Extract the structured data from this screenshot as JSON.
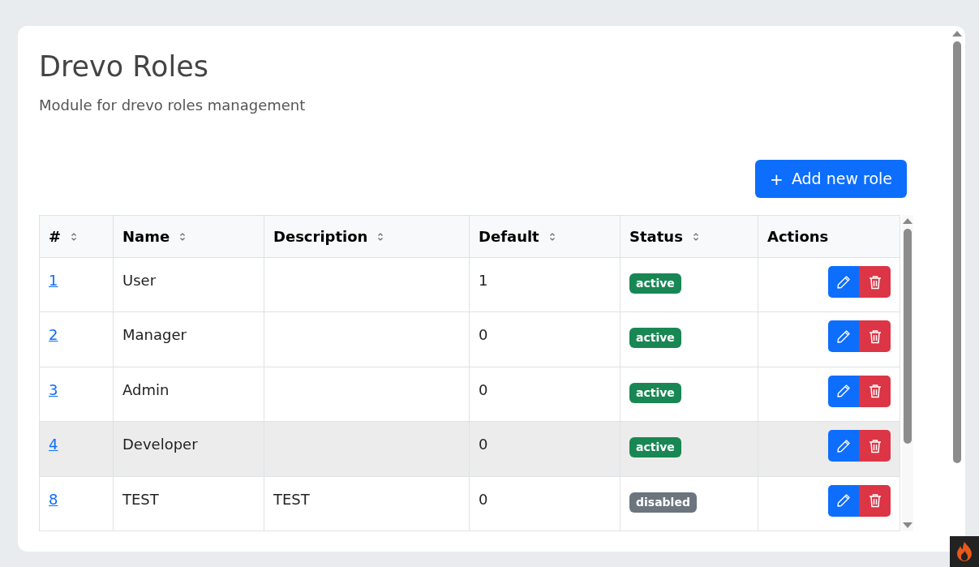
{
  "page": {
    "title": "Drevo Roles",
    "subtitle": "Module for drevo roles management"
  },
  "add_button": {
    "icon": "+",
    "label": "Add new role"
  },
  "table": {
    "columns": [
      {
        "label": "#",
        "sortable": true
      },
      {
        "label": "Name",
        "sortable": true
      },
      {
        "label": "Description",
        "sortable": true
      },
      {
        "label": "Default",
        "sortable": true
      },
      {
        "label": "Status",
        "sortable": true
      },
      {
        "label": "Actions",
        "sortable": false
      }
    ],
    "rows": [
      {
        "id": "1",
        "name": "User",
        "default": "1",
        "status": {
          "label": "active",
          "kind": "active"
        },
        "hovered": false
      },
      {
        "id": "2",
        "name": "Manager",
        "default": "0",
        "status": {
          "label": "active",
          "kind": "active"
        },
        "hovered": false
      },
      {
        "id": "3",
        "name": "Admin",
        "default": "0",
        "status": {
          "label": "active",
          "kind": "active"
        },
        "hovered": false
      },
      {
        "id": "4",
        "name": "Developer",
        "default": "0",
        "status": {
          "label": "active",
          "kind": "active"
        },
        "hovered": true
      },
      {
        "id": "8",
        "name": "TEST",
        "description": "TEST",
        "default": "0",
        "status": {
          "label": "disabled",
          "kind": "disabled"
        },
        "hovered": false
      }
    ]
  }
}
